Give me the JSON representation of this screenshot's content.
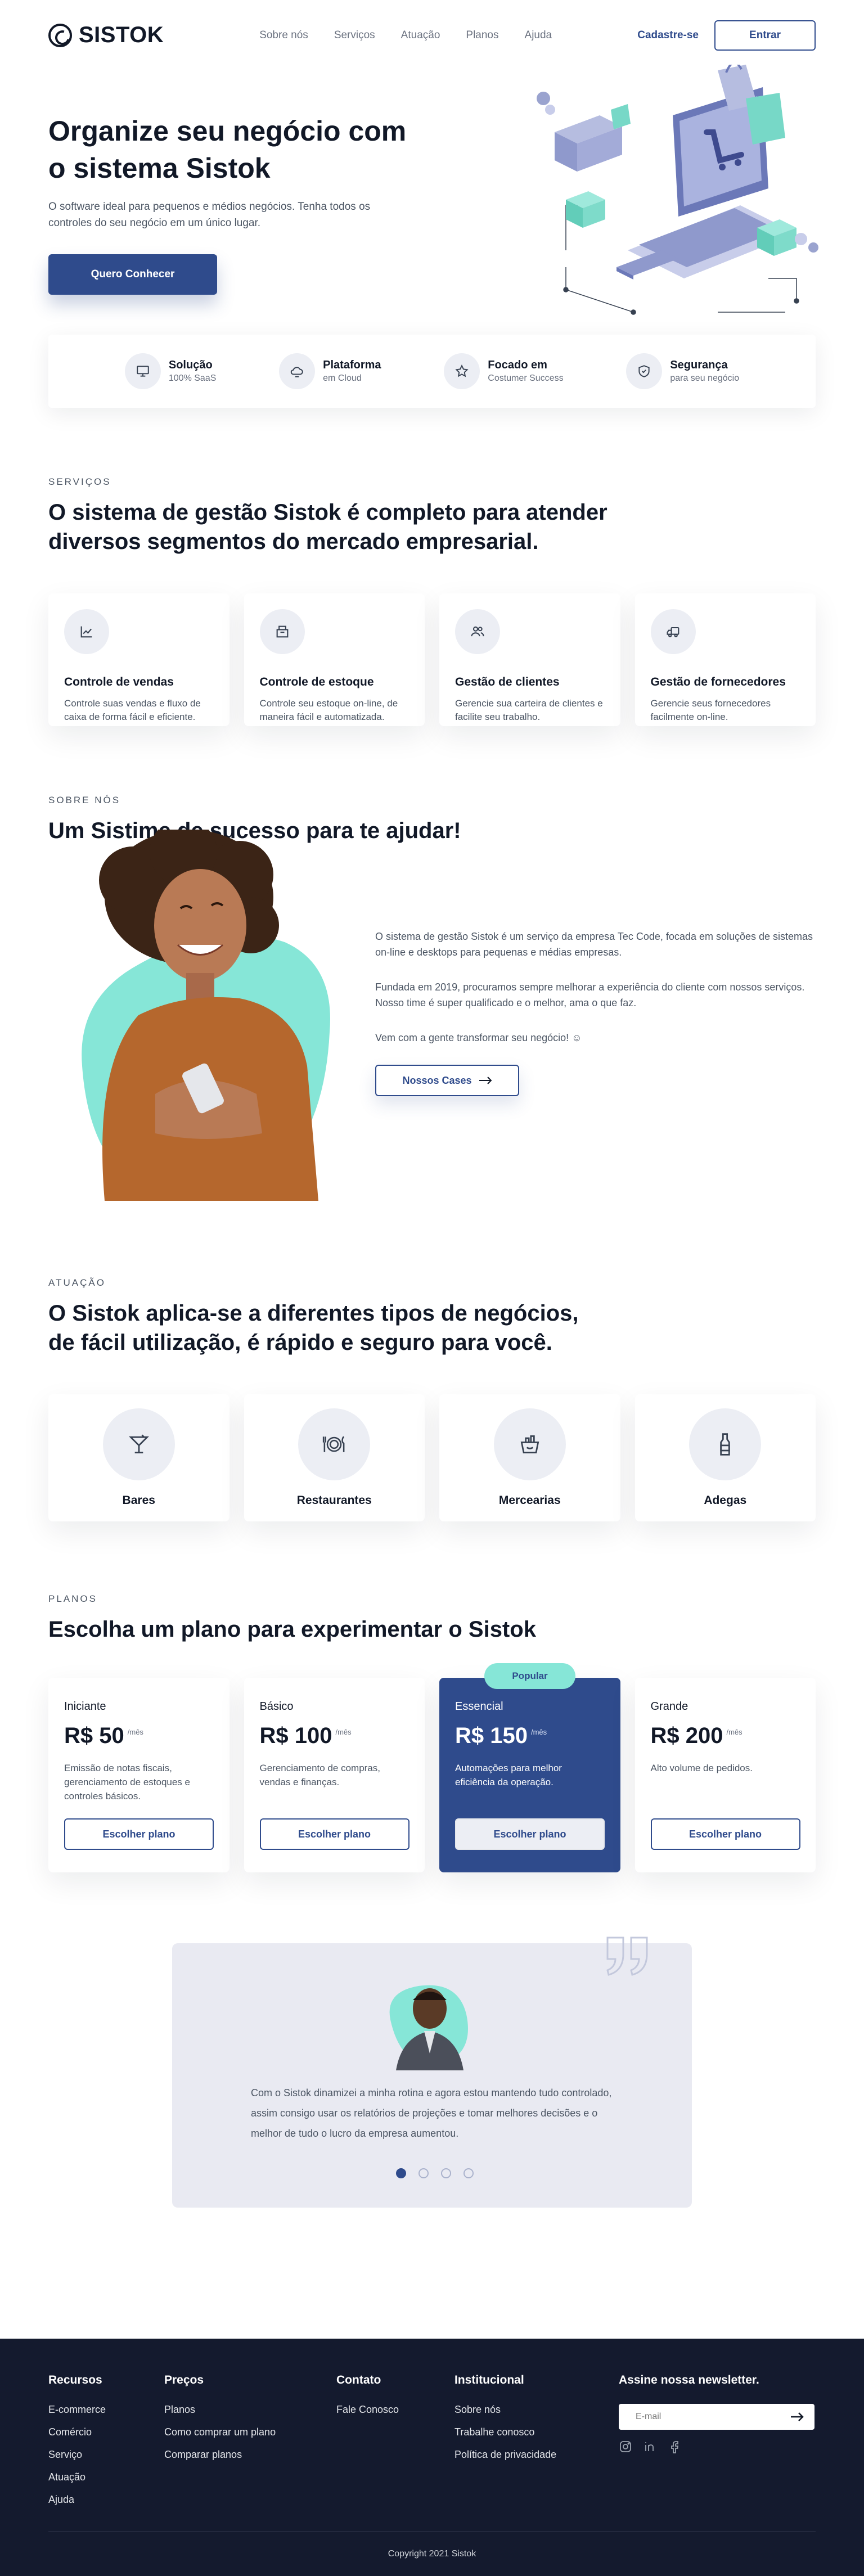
{
  "header": {
    "logo_text": "SISTOK",
    "nav": [
      "Sobre nós",
      "Serviços",
      "Atuação",
      "Planos",
      "Ajuda"
    ],
    "signup_label": "Cadastre-se",
    "login_label": "Entrar"
  },
  "hero": {
    "title": "Organize seu negócio com o sistema Sistok",
    "subtitle": "O software ideal para pequenos e médios negócios. Tenha todos os controles do seu negócio em um único lugar.",
    "cta_label": "Quero Conhecer"
  },
  "features": [
    {
      "title": "Solução",
      "sub": "100% SaaS",
      "icon": "monitor-icon"
    },
    {
      "title": "Plataforma",
      "sub": "em Cloud",
      "icon": "cloud-icon"
    },
    {
      "title": "Focado em",
      "sub": "Costumer Success",
      "icon": "star-icon"
    },
    {
      "title": "Segurança",
      "sub": "para seu negócio",
      "icon": "shield-icon"
    }
  ],
  "services": {
    "eyebrow": "SERVIÇOS",
    "title": "O sistema de gestão Sistok é completo para atender diversos segmentos do mercado empresarial.",
    "items": [
      {
        "title": "Controle de vendas",
        "desc": "Controle suas vendas e fluxo de caixa de forma fácil e eficiente.",
        "icon": "chart-line-icon"
      },
      {
        "title": "Controle de estoque",
        "desc": "Controle seu estoque on-line, de maneira fácil e automatizada.",
        "icon": "box-icon"
      },
      {
        "title": "Gestão de clientes",
        "desc": "Gerencie sua carteira de clientes e facilite seu trabalho.",
        "icon": "users-icon"
      },
      {
        "title": "Gestão de fornecedores",
        "desc": "Gerencie seus fornecedores facilmente on-line.",
        "icon": "truck-icon"
      }
    ]
  },
  "about": {
    "eyebrow": "SOBRE NÓS",
    "title": "Um Sistime de sucesso para te ajudar!",
    "p1": "O sistema de gestão Sistok é um serviço da empresa Tec Code, focada em soluções de sistemas on-line e desktops para pequenas e médias empresas.",
    "p2": "Fundada em 2019, procuramos sempre melhorar a experiência do cliente com nossos serviços. Nosso time é super qualificado e o melhor, ama o que faz.",
    "p3": "Vem com a gente transformar seu negócio! ☺",
    "cta_label": "Nossos Cases"
  },
  "business": {
    "eyebrow": "ATUAÇÃO",
    "title": "O Sistok aplica-se a diferentes tipos de negócios, de fácil utilização, é rápido e seguro para você.",
    "items": [
      {
        "title": "Bares",
        "icon": "cocktail-icon"
      },
      {
        "title": "Restaurantes",
        "icon": "plate-cutlery-icon"
      },
      {
        "title": "Mercearias",
        "icon": "basket-icon"
      },
      {
        "title": "Adegas",
        "icon": "bottle-icon"
      }
    ]
  },
  "plans": {
    "eyebrow": "PLANOS",
    "title": "Escolha um plano para experimentar o Sistok",
    "per": "/mês",
    "button_label": "Escolher plano",
    "popular_label": "Popular",
    "items": [
      {
        "name": "Iniciante",
        "price": "R$ 50",
        "desc": "Emissão de notas fiscais, gerenciamento de estoques e controles básicos."
      },
      {
        "name": "Básico",
        "price": "R$ 100",
        "desc": "Gerenciamento de compras, vendas e finanças."
      },
      {
        "name": "Essencial",
        "price": "R$ 150",
        "desc": "Automações para melhor eficiência da operação."
      },
      {
        "name": "Grande",
        "price": "R$ 200",
        "desc": "Alto volume de pedidos."
      }
    ]
  },
  "testimonial": {
    "text": "Com o Sistok dinamizei a minha rotina e agora estou mantendo tudo controlado, assim consigo usar os relatórios de projeções e tomar melhores decisões e o melhor de tudo o lucro da empresa aumentou."
  },
  "footer": {
    "resources_head": "Recursos",
    "resources": [
      "E-commerce",
      "Comércio",
      "Serviço",
      "Atuação",
      "Ajuda"
    ],
    "prices_head": "Preços",
    "prices": [
      "Planos",
      "Como comprar um plano",
      "Comparar planos"
    ],
    "contact_head": "Contato",
    "contact": [
      "Fale Conosco"
    ],
    "institutional_head": "Institucional",
    "institutional": [
      "Sobre nós",
      "Trabalhe conosco",
      "Política de privacidade"
    ],
    "newsletter_head": "Assine nossa newsletter.",
    "newsletter_placeholder": "E-mail",
    "copyright": "Copyright 2021 Sistok"
  },
  "colors": {
    "primary": "#2f4b8c",
    "accent": "#86e6d7",
    "footer_bg": "#141a2e"
  }
}
